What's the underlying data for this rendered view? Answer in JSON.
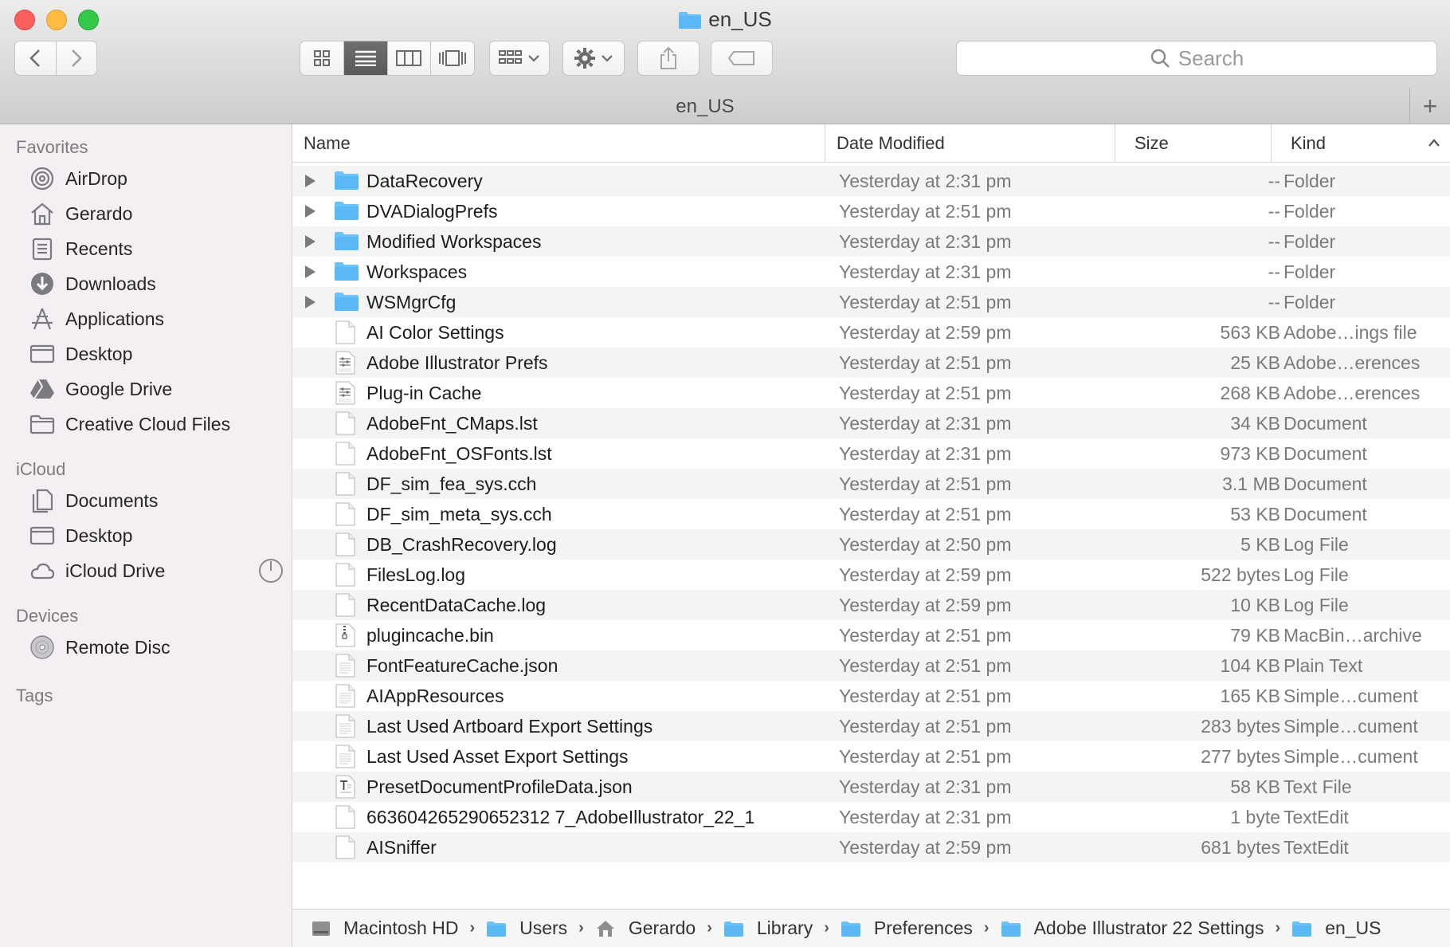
{
  "window": {
    "title": "en_US",
    "tab_label": "en_US",
    "tab_add": "+"
  },
  "toolbar": {
    "search_placeholder": "Search",
    "view_modes": [
      "icon-view",
      "list-view",
      "column-view",
      "cover-flow-view"
    ],
    "active_view": "list-view"
  },
  "sidebar": {
    "sections": [
      {
        "header": "Favorites",
        "items": [
          {
            "label": "AirDrop",
            "icon": "airdrop-icon"
          },
          {
            "label": "Gerardo",
            "icon": "home-icon"
          },
          {
            "label": "Recents",
            "icon": "recents-icon"
          },
          {
            "label": "Downloads",
            "icon": "downloads-icon"
          },
          {
            "label": "Applications",
            "icon": "applications-icon"
          },
          {
            "label": "Desktop",
            "icon": "desktop-icon"
          },
          {
            "label": "Google Drive",
            "icon": "google-drive-icon"
          },
          {
            "label": "Creative Cloud Files",
            "icon": "folder-icon"
          }
        ]
      },
      {
        "header": "iCloud",
        "items": [
          {
            "label": "Documents",
            "icon": "documents-icon"
          },
          {
            "label": "Desktop",
            "icon": "desktop-icon"
          },
          {
            "label": "iCloud Drive",
            "icon": "cloud-icon"
          }
        ]
      },
      {
        "header": "Devices",
        "items": [
          {
            "label": "Remote Disc",
            "icon": "disc-icon"
          }
        ]
      },
      {
        "header": "Tags",
        "items": []
      }
    ]
  },
  "list": {
    "columns": [
      "Name",
      "Date Modified",
      "Size",
      "Kind"
    ],
    "sort_column": "Kind",
    "rows": [
      {
        "name": "DataRecovery",
        "date": "Yesterday at 2:31 pm",
        "size": "--",
        "kind": "Folder",
        "type": "folder"
      },
      {
        "name": "DVADialogPrefs",
        "date": "Yesterday at 2:51 pm",
        "size": "--",
        "kind": "Folder",
        "type": "folder"
      },
      {
        "name": "Modified Workspaces",
        "date": "Yesterday at 2:31 pm",
        "size": "--",
        "kind": "Folder",
        "type": "folder"
      },
      {
        "name": "Workspaces",
        "date": "Yesterday at 2:31 pm",
        "size": "--",
        "kind": "Folder",
        "type": "folder"
      },
      {
        "name": "WSMgrCfg",
        "date": "Yesterday at 2:51 pm",
        "size": "--",
        "kind": "Folder",
        "type": "folder"
      },
      {
        "name": "AI Color Settings",
        "date": "Yesterday at 2:59 pm",
        "size": "563 KB",
        "kind": "Adobe…ings file",
        "type": "doc"
      },
      {
        "name": "Adobe Illustrator Prefs",
        "date": "Yesterday at 2:51 pm",
        "size": "25 KB",
        "kind": "Adobe…erences",
        "type": "prefs"
      },
      {
        "name": "Plug-in Cache",
        "date": "Yesterday at 2:51 pm",
        "size": "268 KB",
        "kind": "Adobe…erences",
        "type": "prefs"
      },
      {
        "name": "AdobeFnt_CMaps.lst",
        "date": "Yesterday at 2:31 pm",
        "size": "34 KB",
        "kind": "Document",
        "type": "doc"
      },
      {
        "name": "AdobeFnt_OSFonts.lst",
        "date": "Yesterday at 2:31 pm",
        "size": "973 KB",
        "kind": "Document",
        "type": "doc"
      },
      {
        "name": "DF_sim_fea_sys.cch",
        "date": "Yesterday at 2:51 pm",
        "size": "3.1 MB",
        "kind": "Document",
        "type": "doc"
      },
      {
        "name": "DF_sim_meta_sys.cch",
        "date": "Yesterday at 2:51 pm",
        "size": "53 KB",
        "kind": "Document",
        "type": "doc"
      },
      {
        "name": "DB_CrashRecovery.log",
        "date": "Yesterday at 2:50 pm",
        "size": "5 KB",
        "kind": "Log File",
        "type": "doc"
      },
      {
        "name": "FilesLog.log",
        "date": "Yesterday at 2:59 pm",
        "size": "522 bytes",
        "kind": "Log File",
        "type": "doc"
      },
      {
        "name": "RecentDataCache.log",
        "date": "Yesterday at 2:59 pm",
        "size": "10 KB",
        "kind": "Log File",
        "type": "doc"
      },
      {
        "name": "plugincache.bin",
        "date": "Yesterday at 2:51 pm",
        "size": "79 KB",
        "kind": "MacBin…archive",
        "type": "archive"
      },
      {
        "name": "FontFeatureCache.json",
        "date": "Yesterday at 2:51 pm",
        "size": "104 KB",
        "kind": "Plain Text",
        "type": "lines"
      },
      {
        "name": "AIAppResources",
        "date": "Yesterday at 2:51 pm",
        "size": "165 KB",
        "kind": "Simple…cument",
        "type": "lines"
      },
      {
        "name": "Last Used Artboard Export Settings",
        "date": "Yesterday at 2:51 pm",
        "size": "283 bytes",
        "kind": "Simple…cument",
        "type": "lines"
      },
      {
        "name": "Last Used Asset Export Settings",
        "date": "Yesterday at 2:51 pm",
        "size": "277 bytes",
        "kind": "Simple…cument",
        "type": "lines"
      },
      {
        "name": "PresetDocumentProfileData.json",
        "date": "Yesterday at 2:31 pm",
        "size": "58 KB",
        "kind": "Text File",
        "type": "text"
      },
      {
        "name": "663604265290652312 7_AdobeIllustrator_22_1",
        "date": "Yesterday at 2:31 pm",
        "size": "1 byte",
        "kind": "TextEdit",
        "type": "doc"
      },
      {
        "name": "AISniffer",
        "date": "Yesterday at 2:59 pm",
        "size": "681 bytes",
        "kind": "TextEdit",
        "type": "doc"
      }
    ]
  },
  "pathbar": [
    {
      "label": "Macintosh HD",
      "icon": "hard-drive-icon"
    },
    {
      "label": "Users",
      "icon": "folder-icon"
    },
    {
      "label": "Gerardo",
      "icon": "home-icon"
    },
    {
      "label": "Library",
      "icon": "folder-icon"
    },
    {
      "label": "Preferences",
      "icon": "folder-icon"
    },
    {
      "label": "Adobe Illustrator 22 Settings",
      "icon": "folder-icon"
    },
    {
      "label": "en_US",
      "icon": "folder-icon"
    }
  ],
  "colors": {
    "folder": "#5ab8f5",
    "sidebar_bg": "#f3eff3",
    "accent_view": "#5f5f5f"
  }
}
